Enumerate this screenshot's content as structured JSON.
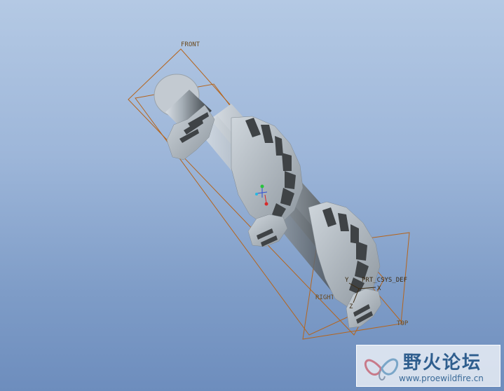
{
  "viewport": {
    "datum_planes": {
      "front": "FRONT",
      "right": "RIGHT",
      "top": "TOP"
    },
    "csys": {
      "label": "PRT_CSYS_DEF",
      "axis_x": "X",
      "axis_y": "Y",
      "axis_z": "Z"
    }
  },
  "watermark": {
    "title": "野火论坛",
    "url": "www.proewildfire.cn"
  },
  "colors": {
    "background_top": "#b4c9e4",
    "background_bottom": "#6d8dbd",
    "datum_plane": "#b5651d",
    "model_face": "#a9b2ba",
    "model_shadow": "#3f4346",
    "watermark_text": "#2f5e8e"
  }
}
